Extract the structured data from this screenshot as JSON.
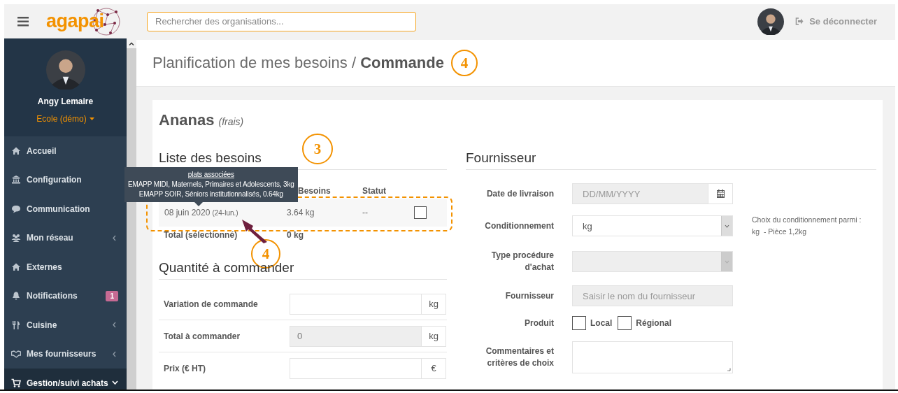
{
  "topbar": {
    "logo": "agapai",
    "search": {
      "placeholder": "Rechercher des organisations..."
    },
    "logout": "Se déconnecter"
  },
  "sidebar": {
    "user": "Angy Lemaire",
    "organization": "Ecole (démo)",
    "items": [
      {
        "label": "Accueil",
        "has_submenu": false,
        "selected": false
      },
      {
        "label": "Configuration",
        "has_submenu": false,
        "selected": false
      },
      {
        "label": "Communication",
        "has_submenu": false,
        "selected": false
      },
      {
        "label": "Mon réseau",
        "has_submenu": true,
        "selected": false
      },
      {
        "label": "Externes",
        "has_submenu": false,
        "selected": false
      },
      {
        "label": "Notifications",
        "has_submenu": false,
        "selected": false,
        "badge": "1"
      },
      {
        "label": "Cuisine",
        "has_submenu": true,
        "selected": false
      },
      {
        "label": "Mes fournisseurs",
        "has_submenu": true,
        "selected": false
      },
      {
        "label": "Gestion/suivi achats",
        "has_submenu": true,
        "selected": true
      }
    ]
  },
  "page_title": {
    "text": "Planification de mes besoins / **Commande**",
    "marker": "4"
  },
  "product": {
    "name": "Ananas",
    "qualifier": "(frais)"
  },
  "needs": {
    "title": "Liste des besoins",
    "marker": "3",
    "columns": [
      "Besoins",
      "Statut"
    ],
    "rows": [
      {
        "date": "08 juin 2020",
        "day": "(24-lun.)",
        "quantity": "3.64 kg",
        "status": "--",
        "checked": false
      }
    ],
    "row_marker": "4",
    "total_label": "Total (sélectionné)",
    "total": "0 kg",
    "tooltip": {
      "title": "plats associées",
      "lines": [
        "EMAPP MIDI, Maternels, Primaires et Adolescents, 3kg",
        "EMAPP SOIR, Séniors institutionnalisés, 0.64kg"
      ]
    }
  },
  "order": {
    "title": "Quantité à commander",
    "fields": [
      {
        "label": "Variation de commande",
        "unit": "kg",
        "disabled": false
      },
      {
        "label": "Total à commander",
        "value": "0",
        "unit": "kg",
        "disabled": true
      },
      {
        "label": "Prix (€ HT)",
        "unit": "€",
        "disabled": false
      }
    ]
  },
  "supplier": {
    "title": "Fournisseur",
    "fields": [
      {
        "kind": "date",
        "label": "Date de livraison",
        "placeholder": "DD/MM/YYYY",
        "disabled": true
      },
      {
        "kind": "select",
        "label": "Conditionnement",
        "value": "kg",
        "disabled": false,
        "hint_lines": [
          "Choix du conditionnement parmi :",
          "kg  - Pièce 1,2kg"
        ]
      },
      {
        "kind": "select",
        "label": "Type procédure d'achat",
        "disabled": true
      },
      {
        "kind": "text",
        "label": "Fournisseur",
        "placeholder": "Saisir le nom du fournisseur",
        "disabled": true
      },
      {
        "kind": "checkboxes",
        "label": "Produit",
        "options": [
          {
            "label": "Local",
            "checked": false
          },
          {
            "label": "Régional",
            "checked": false
          }
        ]
      },
      {
        "kind": "textarea",
        "label": "Commentaires et critères de choix"
      }
    ]
  }
}
